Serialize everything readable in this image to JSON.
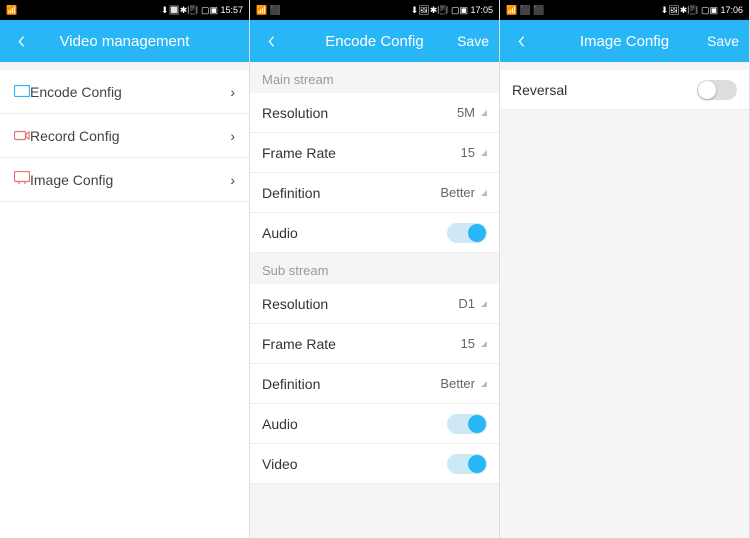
{
  "screens": [
    {
      "statusbar": {
        "left": "📶",
        "right": "⬇🔲✱📳 ▢▣ 15:57"
      },
      "title": "Video management",
      "save": null,
      "body_white": true,
      "menu": [
        {
          "icon": "encode",
          "label": "Encode Config"
        },
        {
          "icon": "record",
          "label": "Record Config"
        },
        {
          "icon": "image",
          "label": "Image Config"
        }
      ]
    },
    {
      "statusbar": {
        "left": "📶 ⬛",
        "right": "⬇🖼✱📳 ▢▣ 17:05"
      },
      "title": "Encode Config",
      "save": "Save",
      "groups": [
        {
          "title": "Main stream",
          "rows": [
            {
              "label": "Resolution",
              "value": "5M",
              "type": "select"
            },
            {
              "label": "Frame Rate",
              "value": "15",
              "type": "select"
            },
            {
              "label": "Definition",
              "value": "Better",
              "type": "select"
            },
            {
              "label": "Audio",
              "type": "toggle",
              "on": true
            }
          ]
        },
        {
          "title": "Sub stream",
          "rows": [
            {
              "label": "Resolution",
              "value": "D1",
              "type": "select"
            },
            {
              "label": "Frame Rate",
              "value": "15",
              "type": "select"
            },
            {
              "label": "Definition",
              "value": "Better",
              "type": "select"
            },
            {
              "label": "Audio",
              "type": "toggle",
              "on": true
            },
            {
              "label": "Video",
              "type": "toggle",
              "on": true
            }
          ]
        }
      ]
    },
    {
      "statusbar": {
        "left": "📶 ⬛ ⬛",
        "right": "⬇🖼✱📳 ▢▣ 17:06"
      },
      "title": "Image Config",
      "save": "Save",
      "groups": [
        {
          "title": null,
          "rows": [
            {
              "label": "Reversal",
              "type": "toggle",
              "on": false
            }
          ]
        }
      ]
    }
  ],
  "icons": {
    "encode": "▭",
    "record": "⦾",
    "image": "🖵"
  }
}
